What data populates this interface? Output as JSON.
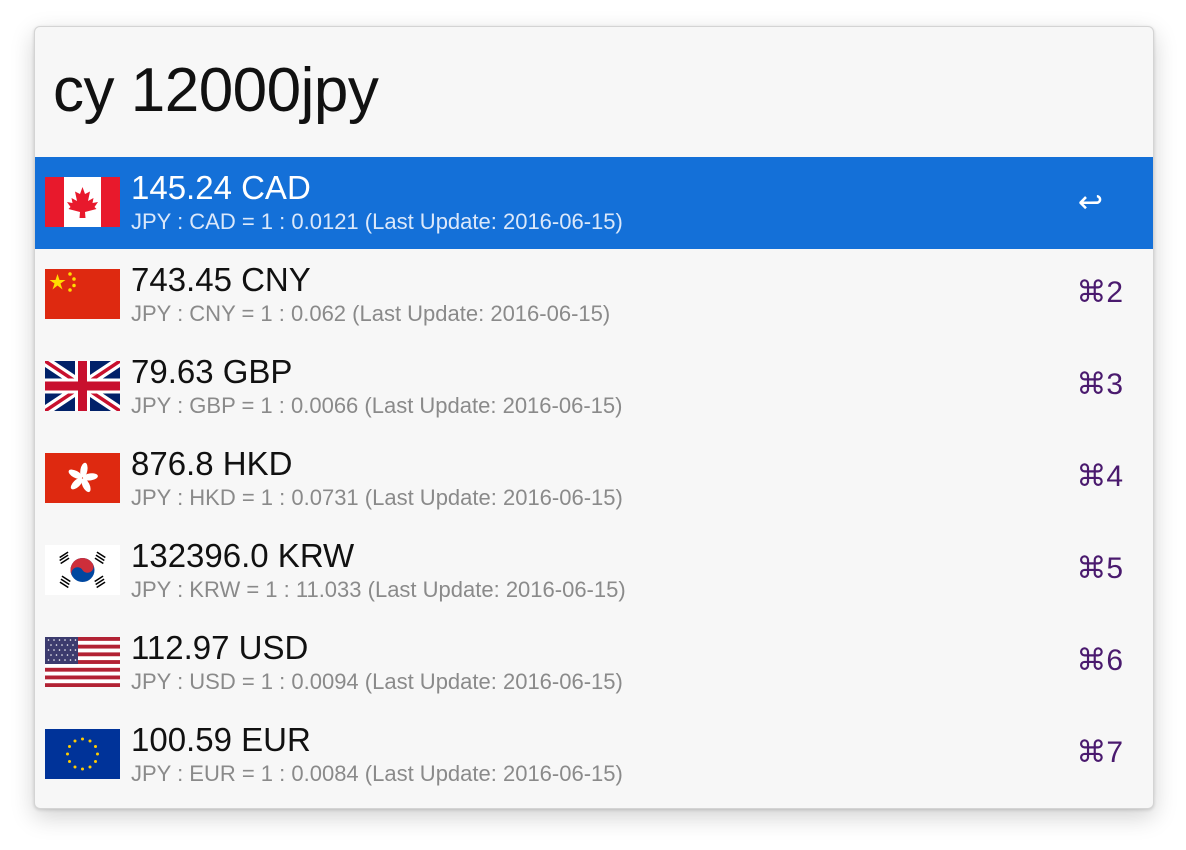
{
  "query": "cy 12000jpy",
  "results": [
    {
      "title": "145.24 CAD",
      "subtitle": "JPY : CAD = 1 : 0.0121 (Last Update: 2016-06-15)",
      "shortcut": "↩",
      "flag": "canada-flag-icon",
      "selected": true
    },
    {
      "title": "743.45 CNY",
      "subtitle": "JPY : CNY = 1 : 0.062 (Last Update: 2016-06-15)",
      "shortcut": "⌘2",
      "flag": "china-flag-icon"
    },
    {
      "title": "79.63 GBP",
      "subtitle": "JPY : GBP = 1 : 0.0066 (Last Update: 2016-06-15)",
      "shortcut": "⌘3",
      "flag": "uk-flag-icon"
    },
    {
      "title": "876.8 HKD",
      "subtitle": "JPY : HKD = 1 : 0.0731 (Last Update: 2016-06-15)",
      "shortcut": "⌘4",
      "flag": "hong-kong-flag-icon"
    },
    {
      "title": "132396.0 KRW",
      "subtitle": "JPY : KRW = 1 : 11.033 (Last Update: 2016-06-15)",
      "shortcut": "⌘5",
      "flag": "south-korea-flag-icon"
    },
    {
      "title": "112.97 USD",
      "subtitle": "JPY : USD = 1 : 0.0094 (Last Update: 2016-06-15)",
      "shortcut": "⌘6",
      "flag": "usa-flag-icon"
    },
    {
      "title": "100.59 EUR",
      "subtitle": "JPY : EUR = 1 : 0.0084 (Last Update: 2016-06-15)",
      "shortcut": "⌘7",
      "flag": "eu-flag-icon"
    }
  ],
  "colors": {
    "selection": "#1470d8",
    "shortcut": "#4a1a6e",
    "subtitle": "#8a8a8a"
  }
}
